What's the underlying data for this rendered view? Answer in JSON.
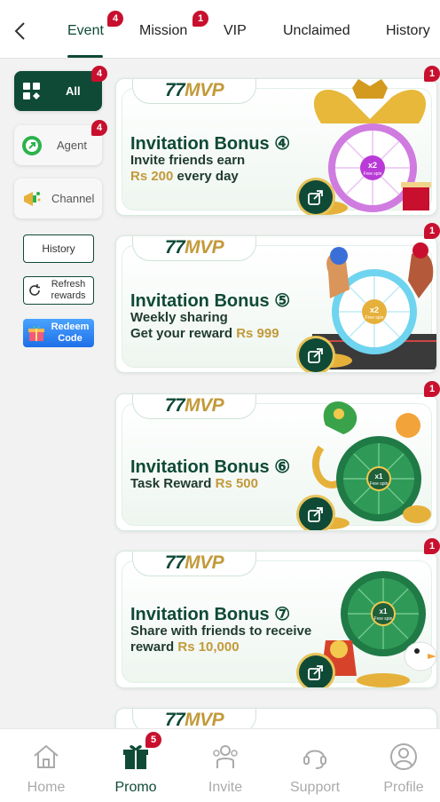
{
  "tabs": [
    {
      "label": "Event",
      "badge": "4"
    },
    {
      "label": "Mission",
      "badge": "1"
    },
    {
      "label": "VIP"
    },
    {
      "label": "Unclaimed"
    },
    {
      "label": "History"
    }
  ],
  "sidebar": {
    "items": [
      {
        "label": "All",
        "badge": "4"
      },
      {
        "label": "Agent",
        "badge": "4"
      },
      {
        "label": "Channel"
      }
    ],
    "history_label": "History",
    "refresh_label": "Refresh rewards",
    "redeem_label": "Redeem Code"
  },
  "brand": {
    "part1": "77",
    "part2": "MVP"
  },
  "cards": [
    {
      "title": "Invitation Bonus ④",
      "line1": "Invite friends earn",
      "line2_amount": "Rs 200",
      "line2_rest": " every day",
      "badge": "1",
      "multiplier": "x2",
      "spin_label": "Free spin"
    },
    {
      "title": "Invitation Bonus ⑤",
      "line1": "Weekly sharing",
      "line2_text": "Get your reward ",
      "line2_amount": "Rs 999",
      "badge": "1",
      "multiplier": "x2",
      "spin_label": "Free spin"
    },
    {
      "title": "Invitation Bonus ⑥",
      "line1_text": "Task Reward ",
      "line1_amount": "Rs 500",
      "badge": "1",
      "multiplier": "x1",
      "spin_label": "Free spin"
    },
    {
      "title": "Invitation Bonus ⑦",
      "line1": "Share with friends to receive",
      "line2_text": "reward ",
      "line2_amount": "Rs 10,000",
      "badge": "1",
      "multiplier": "x1",
      "spin_label": "Free spin"
    }
  ],
  "bottom_nav": [
    {
      "label": "Home"
    },
    {
      "label": "Promo",
      "badge": "5"
    },
    {
      "label": "Invite"
    },
    {
      "label": "Support"
    },
    {
      "label": "Profile"
    }
  ],
  "colors": {
    "primary": "#0f4a36",
    "gold": "#c29a3a",
    "badge": "#c8102e"
  }
}
